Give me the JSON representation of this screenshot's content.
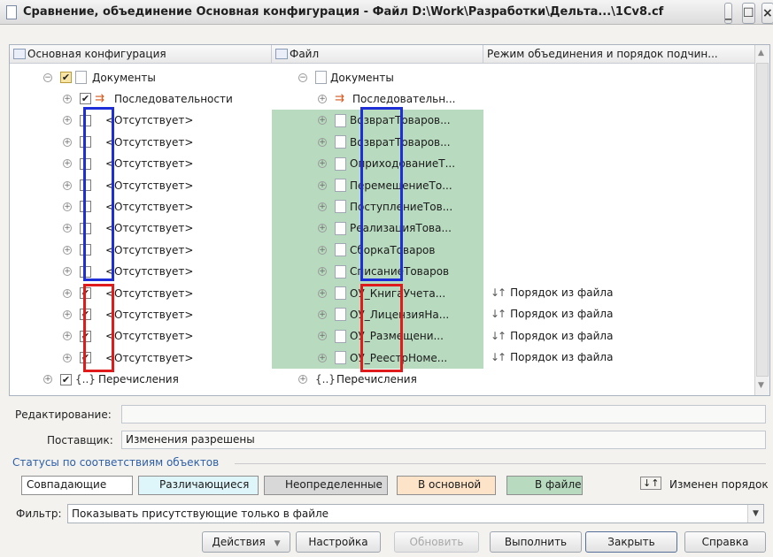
{
  "window": {
    "title": "Сравнение, объединение Основная конфигурация - Файл D:\\Work\\Разработки\\Дельта...\\1Cv8.cf",
    "minimize": "_",
    "maximize": "☐",
    "close": "×"
  },
  "grid": {
    "headers": [
      "Основная конфигурация",
      "Файл",
      "Режим объединения и порядок подчин..."
    ],
    "rows": [
      {
        "left": "Документы",
        "right": "Документы",
        "mode": "",
        "left_check": "✔",
        "left_icon": "doc",
        "right_icon": "doc",
        "green": false,
        "level": 1,
        "expanded": true
      },
      {
        "left": "Последовательности",
        "right": "Последовательн...",
        "mode": "",
        "left_check": "✔",
        "left_icon": "seq",
        "right_icon": "seq",
        "green": false,
        "level": 2,
        "expanded": false
      },
      {
        "left": "<Отсутствует>",
        "right": "ВозвратТоваров...",
        "mode": "",
        "left_check": "",
        "green": true,
        "level": 2
      },
      {
        "left": "<Отсутствует>",
        "right": "ВозвратТоваров...",
        "mode": "",
        "left_check": "",
        "green": true,
        "level": 2
      },
      {
        "left": "<Отсутствует>",
        "right": "ОприходованиеТ...",
        "mode": "",
        "left_check": "",
        "green": true,
        "level": 2
      },
      {
        "left": "<Отсутствует>",
        "right": "ПеремещениеТо...",
        "mode": "",
        "left_check": "",
        "green": true,
        "level": 2
      },
      {
        "left": "<Отсутствует>",
        "right": "ПоступлениеТов...",
        "mode": "",
        "left_check": "",
        "green": true,
        "level": 2
      },
      {
        "left": "<Отсутствует>",
        "right": "РеализацияТова...",
        "mode": "",
        "left_check": "",
        "green": true,
        "level": 2
      },
      {
        "left": "<Отсутствует>",
        "right": "СборкаТоваров",
        "mode": "",
        "left_check": "",
        "green": true,
        "level": 2
      },
      {
        "left": "<Отсутствует>",
        "right": "СписаниеТоваров",
        "mode": "",
        "left_check": "",
        "green": true,
        "level": 2
      },
      {
        "left": "<Отсутствует>",
        "right": "ОУ_КнигаУчета...",
        "mode": "Порядок из файла",
        "left_check": "✔",
        "green": true,
        "level": 2
      },
      {
        "left": "<Отсутствует>",
        "right": "ОУ_ЛицензияНа...",
        "mode": "Порядок из файла",
        "left_check": "✔",
        "green": true,
        "level": 2
      },
      {
        "left": "<Отсутствует>",
        "right": "ОУ_Размещени...",
        "mode": "Порядок из файла",
        "left_check": "✔",
        "green": true,
        "level": 2
      },
      {
        "left": "<Отсутствует>",
        "right": "ОУ_РеестрНоме...",
        "mode": "Порядок из файла",
        "left_check": "✔",
        "green": true,
        "level": 2
      },
      {
        "left": "Перечисления",
        "right": "Перечисления",
        "mode": "",
        "left_check": "✔",
        "left_icon": "enum",
        "right_icon": "enum",
        "green": false,
        "level": 1,
        "expanded": false
      }
    ]
  },
  "fields": {
    "edit_label": "Редактирование:",
    "edit_value": "",
    "supplier_label": "Поставщик:",
    "supplier_value": "Изменения разрешены"
  },
  "legend": {
    "title": "Статусы по соответствиям объектов",
    "items": [
      {
        "label": "Совпадающие",
        "color": "#ffffff"
      },
      {
        "label": "Различающиеся",
        "color": "#def6fa"
      },
      {
        "label": "Неопределенные",
        "color": "#d8d8d8"
      },
      {
        "label": "В основной",
        "color": "#fde3c8"
      },
      {
        "label": "В файле",
        "color": "#b8dbbf"
      }
    ],
    "order_label": "Изменен порядок"
  },
  "filter": {
    "label": "Фильтр:",
    "value": "Показывать присутствующие только в файле"
  },
  "buttons": {
    "actions": "Действия",
    "settings": "Настройка",
    "refresh": "Обновить",
    "execute": "Выполнить",
    "close": "Закрыть",
    "help": "Справка"
  }
}
